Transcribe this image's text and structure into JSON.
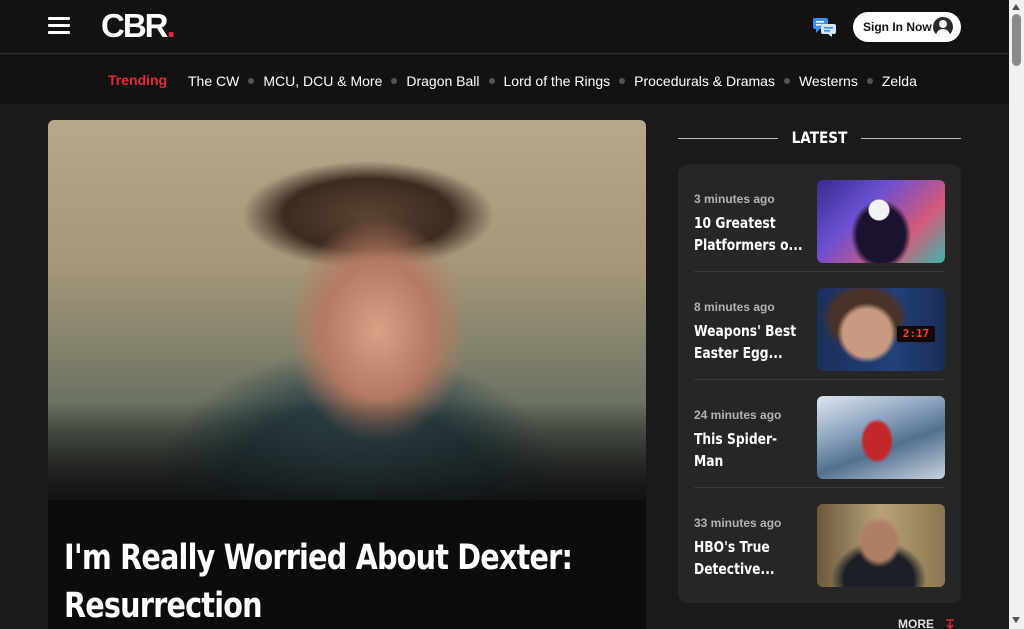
{
  "header": {
    "logo_text": "CBR",
    "logo_dot": ".",
    "signin_label": "Sign In Now",
    "brand_red": "#e6263a"
  },
  "trending": {
    "label": "Trending",
    "items": [
      "The CW",
      "MCU, DCU & More",
      "Dragon Ball",
      "Lord of the Rings",
      "Procedurals & Dramas",
      "Westerns",
      "Zelda"
    ]
  },
  "hero": {
    "title": "I'm Really Worried About Dexter: Resurrection"
  },
  "latest": {
    "heading": "LATEST",
    "items": [
      {
        "time": "3 minutes ago",
        "title": "10 Greatest Platformers o..."
      },
      {
        "time": "8 minutes ago",
        "title": "Weapons' Best Easter Egg..."
      },
      {
        "time": "24 minutes ago",
        "title": "This Spider-Man Character's..."
      },
      {
        "time": "33 minutes ago",
        "title": "HBO's True Detective..."
      }
    ],
    "clock_text": "2:17",
    "more_label": "MORE"
  }
}
